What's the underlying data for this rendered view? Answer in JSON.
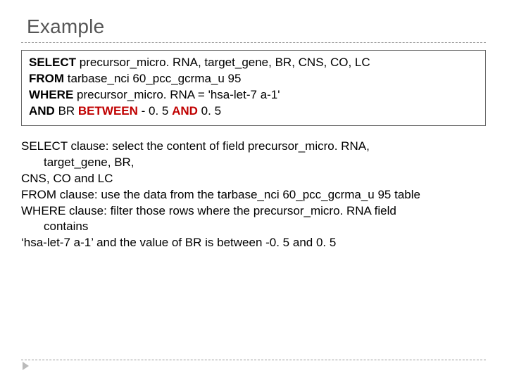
{
  "title": "Example",
  "sql": {
    "l1_kw": "SELECT ",
    "l1_rest": "precursor_micro. RNA, target_gene, BR, CNS, CO, LC",
    "l2_kw": "FROM ",
    "l2_rest": " tarbase_nci 60_pcc_gcrma_u 95",
    "l3_kw": "WHERE ",
    "l3_rest": "precursor_micro. RNA = 'hsa-let-7 a-1'",
    "l4_kw1": "AND ",
    "l4_mid1": "BR ",
    "l4_red1": "BETWEEN ",
    "l4_mid2": "- 0. 5 ",
    "l4_red2": "AND ",
    "l4_mid3": "0. 5"
  },
  "expl": {
    "l1a": "SELECT clause: select the content of field precursor_micro. RNA,",
    "l1b": "target_gene, BR,",
    "l2": "CNS, CO and LC",
    "l3": "FROM clause: use the data from the tarbase_nci 60_pcc_gcrma_u 95 table",
    "l4a": "WHERE clause: filter those rows where the precursor_micro. RNA field",
    "l4b": "contains",
    "l5": "‘hsa-let-7 a-1’ and the value of BR is between -0. 5 and 0. 5"
  }
}
